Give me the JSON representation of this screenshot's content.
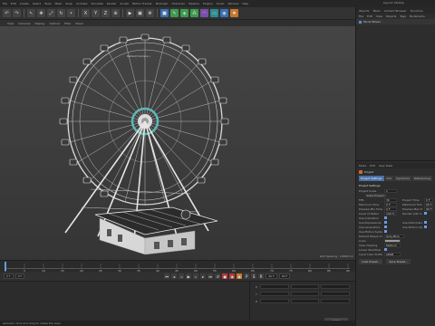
{
  "menubar": {
    "items": [
      "File",
      "Edit",
      "Create",
      "Select",
      "Tools",
      "Mesh",
      "Snap",
      "Animate",
      "Simulate",
      "Render",
      "Sculpt",
      "Motion Tracker",
      "MoGraph",
      "Character",
      "Pipeline",
      "Plugins",
      "Script",
      "Window",
      "Help"
    ],
    "layout_label": "Layout: Startup"
  },
  "right_panel": {
    "obj_tabs": [
      "Objects",
      "Takes",
      "Content Browser",
      "Structure"
    ],
    "obj_menu": [
      "File",
      "Edit",
      "View",
      "Objects",
      "Tags",
      "Bookmarks"
    ],
    "obj_item": "Ferris Wheel",
    "attr_menu": [
      "Mode",
      "Edit",
      "User Data"
    ],
    "attr_title": "Project",
    "attr_tabs": [
      "Project Settings",
      "Info",
      "Dynamics",
      "Referencing"
    ],
    "section": "Project Settings",
    "props_left": [
      {
        "label": "Project Scale",
        "value": "1"
      },
      {
        "label": "Scale Project...",
        "value": ""
      },
      {
        "label": "FPS",
        "value": "30"
      },
      {
        "label": "Minimum Time",
        "value": "0 F"
      },
      {
        "label": "Preview Min Time",
        "value": "0 F"
      },
      {
        "label": "Level of Detail",
        "value": "100 %"
      },
      {
        "label": "Use Animation",
        "value": ""
      },
      {
        "label": "Use Expressions",
        "value": ""
      },
      {
        "label": "Use Generators",
        "value": ""
      },
      {
        "label": "Use Motion System",
        "value": ""
      },
      {
        "label": "Default Object Color",
        "value": "Gray-Blue"
      },
      {
        "label": "Color",
        "value": ""
      },
      {
        "label": "View Clipping",
        "value": "Medium"
      },
      {
        "label": "Linear Workflow",
        "value": ""
      },
      {
        "label": "Input Color Profile",
        "value": "sRGB"
      }
    ],
    "props_right": [
      {
        "label": "Project Time",
        "value": "0 F"
      },
      {
        "label": "Maximum Time",
        "value": "90 F"
      },
      {
        "label": "Preview Max Time",
        "value": "90 F"
      },
      {
        "label": "Render LOD in Editor",
        "value": ""
      },
      {
        "label": "Use Deformers",
        "value": ""
      },
      {
        "label": "Use Motion Clip",
        "value": ""
      }
    ],
    "bottom_buttons": [
      "Load Preset...",
      "Save Preset..."
    ]
  },
  "viewport": {
    "menu": [
      "View",
      "Cameras",
      "Display",
      "Options",
      "Filter",
      "Panel"
    ],
    "camera_label": "Default Camera •",
    "grid_info": "Grid Spacing : 10000 cm"
  },
  "timeline": {
    "ticks": [
      "0",
      "5",
      "10",
      "15",
      "20",
      "25",
      "30",
      "35",
      "40",
      "45",
      "50",
      "55",
      "60",
      "65",
      "70",
      "75",
      "80",
      "85",
      "90"
    ],
    "frame_field": "0 F",
    "start_field": "0 F",
    "end_field": "90 F",
    "end2_field": "90 F"
  },
  "coords": {
    "rows": [
      "X",
      "Y",
      "Z"
    ],
    "apply_label": "Apply"
  },
  "status": "Azimuth: Click and drag to rotate the view."
}
